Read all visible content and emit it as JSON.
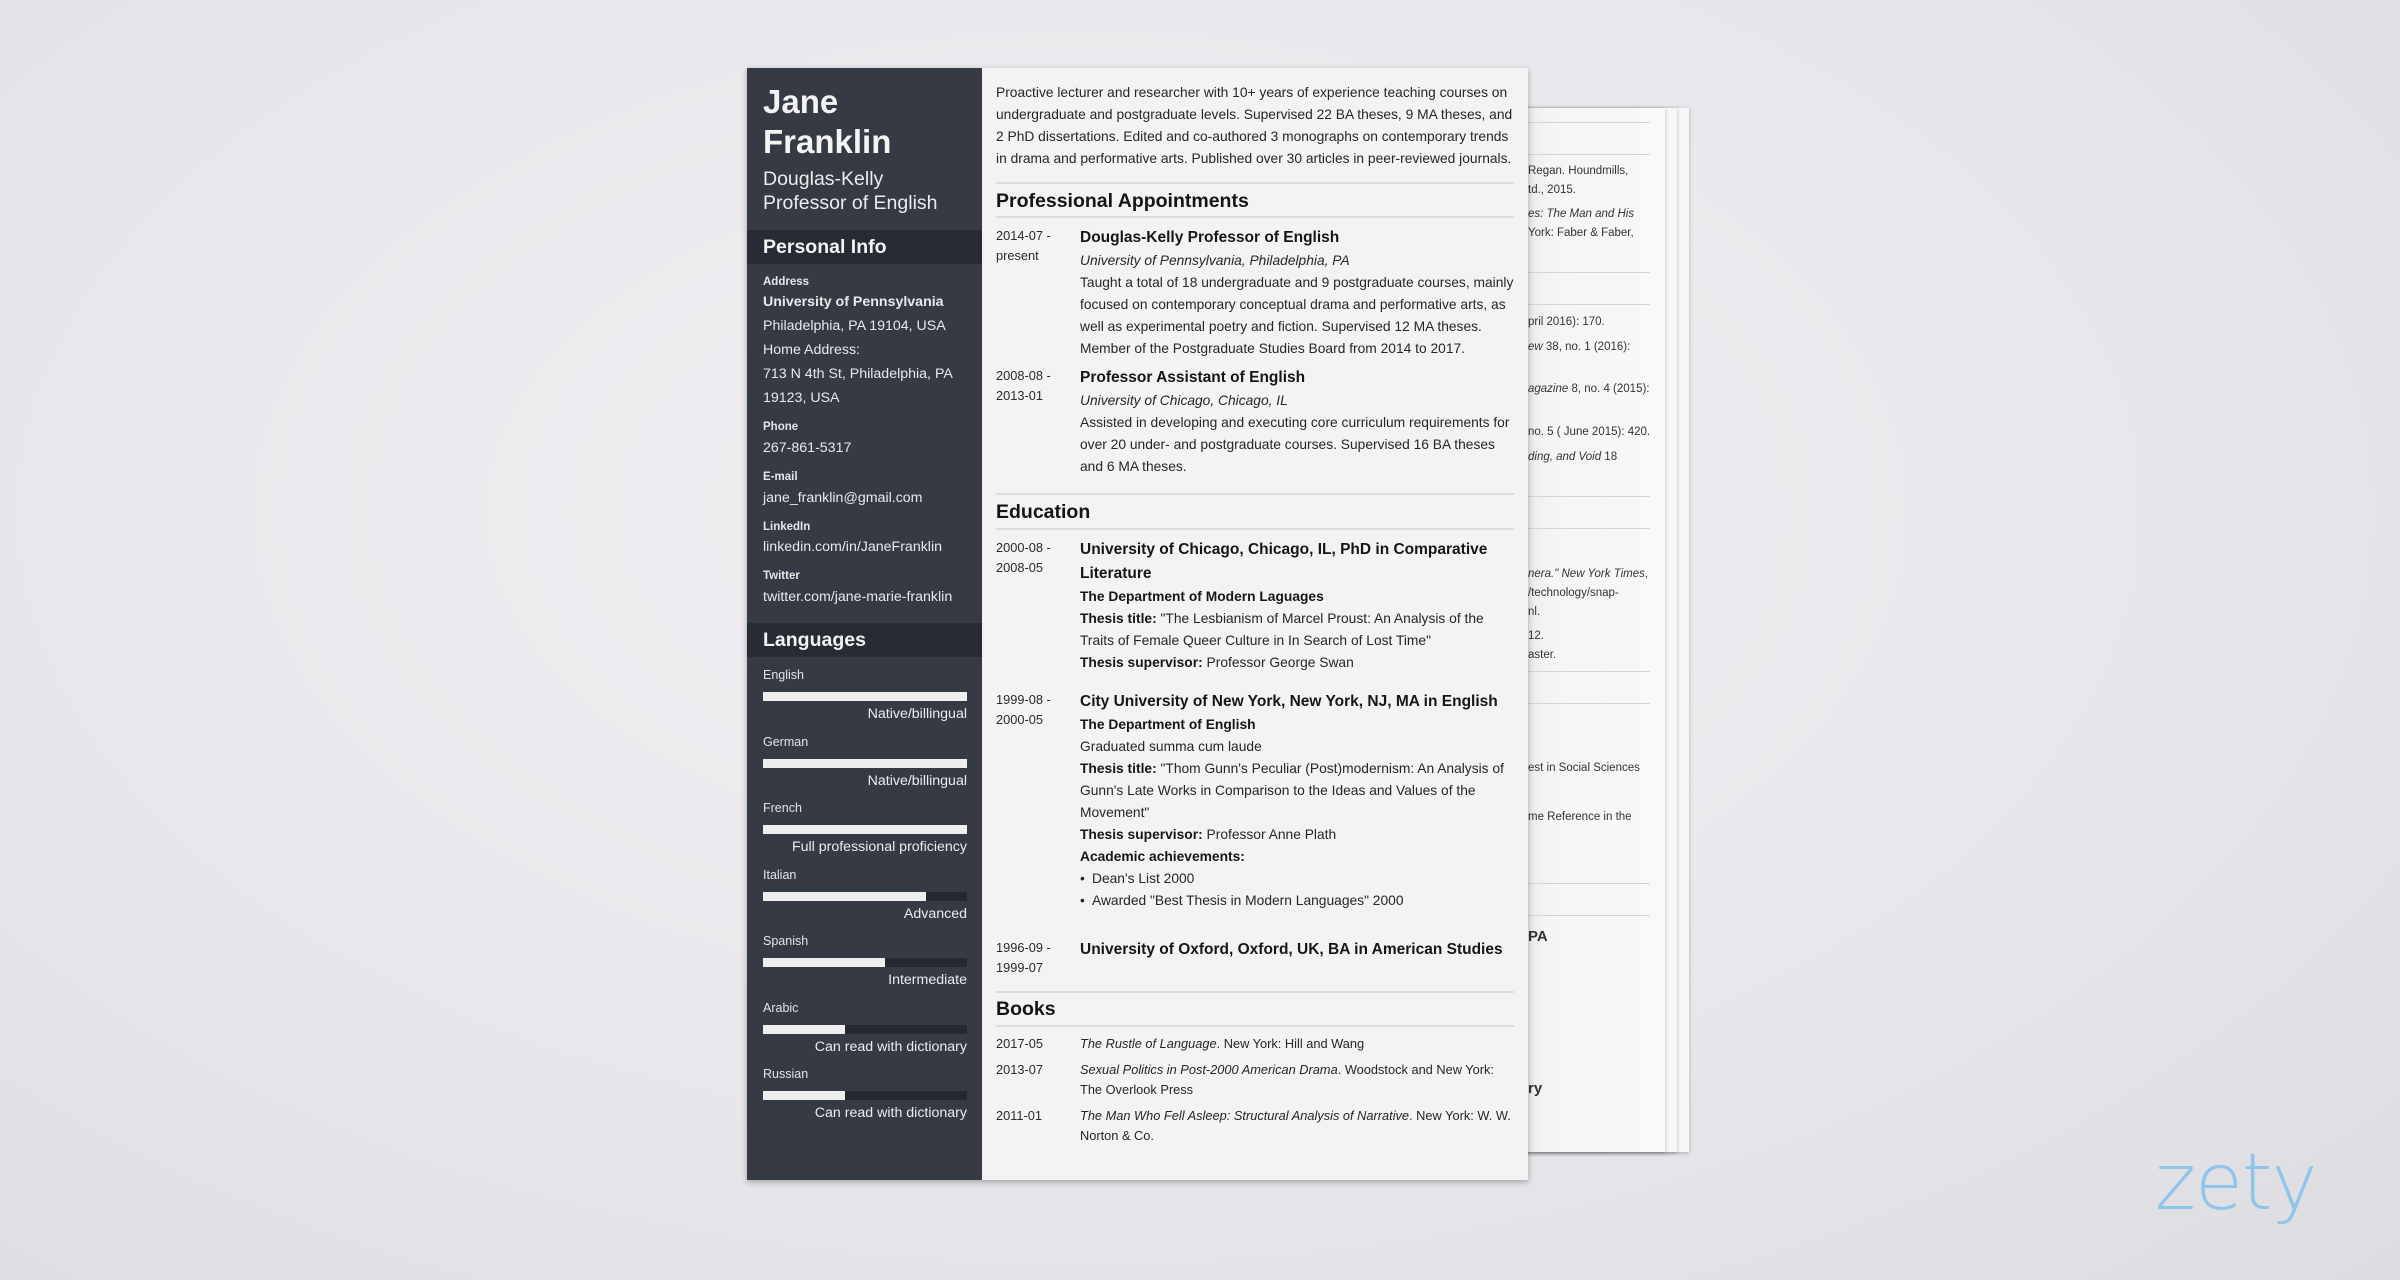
{
  "resume": {
    "name": "Jane Franklin",
    "name_line1": "Jane",
    "name_line2": "Franklin",
    "title_line1": "Douglas-Kelly",
    "title_line2": "Professor of English",
    "personal_info": {
      "heading": "Personal Info",
      "address_label": "Address",
      "address_org": "University of Pennsylvania",
      "address_city": "Philadelphia, PA 19104, USA",
      "home_label": "Home Address:",
      "home_line1": "713 N 4th St, Philadelphia, PA",
      "home_line2": "19123, USA",
      "phone_label": "Phone",
      "phone": "267-861-5317",
      "email_label": "E-mail",
      "email": "jane_franklin@gmail.com",
      "linkedin_label": "LinkedIn",
      "linkedin": "linkedin.com/in/JaneFranklin",
      "twitter_label": "Twitter",
      "twitter": "twitter.com/jane-marie-franklin"
    },
    "languages": {
      "heading": "Languages",
      "items": [
        {
          "name": "English",
          "level": "Native/billingual",
          "proficiency": 1.0
        },
        {
          "name": "German",
          "level": "Native/billingual",
          "proficiency": 1.0
        },
        {
          "name": "French",
          "level": "Full professional proficiency",
          "proficiency": 1.0
        },
        {
          "name": "Italian",
          "level": "Advanced",
          "proficiency": 0.8
        },
        {
          "name": "Spanish",
          "level": "Intermediate",
          "proficiency": 0.6
        },
        {
          "name": "Arabic",
          "level": "Can read with dictionary",
          "proficiency": 0.4
        },
        {
          "name": "Russian",
          "level": "Can read with dictionary",
          "proficiency": 0.4
        }
      ]
    },
    "summary": "Proactive lecturer and researcher with 10+ years of experience teaching courses on undergraduate and postgraduate levels. Supervised 22 BA theses, 9 MA theses, and 2 PhD dissertations. Edited and co-authored 3 monographs on contemporary trends in drama and performative arts. Published over 30 articles in peer-reviewed journals.",
    "appointments": {
      "heading": "Professional Appointments",
      "items": [
        {
          "date_start": "2014-07 -",
          "date_end": "present",
          "title": "Douglas-Kelly Professor of English",
          "org": "University of Pennsylvania, Philadelphia, PA",
          "desc": "Taught a total of 18 undergraduate and 9 postgraduate courses, mainly focused on contemporary conceptual drama and performative arts, as well as experimental poetry and fiction. Supervised 12 MA theses. Member of the Postgraduate Studies Board from 2014 to 2017."
        },
        {
          "date_start": "2008-08 -",
          "date_end": "2013-01",
          "title": "Professor Assistant of English",
          "org": "University of Chicago, Chicago, IL",
          "desc": "Assisted in developing and executing core curriculum requirements for over 20 under- and postgraduate courses. Supervised 16 BA theses and 6 MA theses."
        }
      ]
    },
    "education": {
      "heading": "Education",
      "thesis_title_label": "Thesis title:",
      "thesis_supervisor_label": "Thesis supervisor:",
      "achievements_label": "Academic achievements:",
      "items": [
        {
          "date_start": "2000-08 -",
          "date_end": "2008-05",
          "title": "University of Chicago, Chicago, IL, PhD in Comparative Literature",
          "department": "The Department of Modern Laguages",
          "thesis_title": "\"The Lesbianism of Marcel Proust: An Analysis of the Traits of Female Queer Culture in In Search of Lost Time\"",
          "thesis_supervisor": "Professor George Swan"
        },
        {
          "date_start": "1999-08 -",
          "date_end": "2000-05",
          "title": "City University of New York, New York, NJ, MA in English",
          "department": "The Department of English",
          "note": "Graduated summa cum laude",
          "thesis_title": "\"Thom Gunn's Peculiar (Post)modernism: An Analysis of Gunn's Late Works in Comparison to the Ideas and Values of the Movement\"",
          "thesis_supervisor": "Professor Anne Plath",
          "achievements": [
            "Dean's List 2000",
            "Awarded \"Best Thesis in Modern Languages\" 2000"
          ]
        },
        {
          "date_start": "1996-09 -",
          "date_end": "1999-07",
          "title": "University of Oxford, Oxford, UK, BA in American Studies"
        }
      ]
    },
    "books": {
      "heading": "Books",
      "items": [
        {
          "date": "2017-05",
          "title": "The Rustle of Language",
          "publisher": ". New York: Hill and Wang"
        },
        {
          "date": "2013-07",
          "title": "Sexual Politics in Post-2000 American Drama",
          "publisher": ". Woodstock and New York: The Overlook Press"
        },
        {
          "date": "2011-01",
          "title": "The Man Who Fell Asleep: Structural Analysis of Narrative",
          "publisher": ". New York: W. W. Norton & Co."
        }
      ]
    }
  },
  "back_page": {
    "fragments": [
      {
        "text": "Regan. Houndmills,",
        "italic": ""
      },
      {
        "text": "td., 2015.",
        "italic": ""
      },
      {
        "text": "",
        "italic": "es: The Man and His"
      },
      {
        "text": " York: Faber & Faber,",
        "italic": ""
      },
      {
        "text": "pril 2016): 170.",
        "italic": ""
      },
      {
        "text": " 38, no. 1 (2016):",
        "italic": "ew"
      },
      {
        "text": " 8, no. 4 (2015):",
        "italic": "agazine"
      },
      {
        "text": "no. 5 ( June 2015): 420.",
        "italic": ""
      },
      {
        "text": " 18",
        "italic": "ding, and Void"
      },
      {
        "text": ",",
        "italic": "nera.\" New York Times"
      },
      {
        "text": "/technology/snap-",
        "italic": ""
      },
      {
        "text": "nl.",
        "italic": ""
      },
      {
        "text": "12.",
        "italic": ""
      },
      {
        "text": "aster.",
        "italic": ""
      },
      {
        "text": "est in Social Sciences",
        "italic": ""
      },
      {
        "text": "me Reference in the",
        "italic": ""
      },
      {
        "text": "PA",
        "italic": ""
      },
      {
        "text": "ry",
        "italic": ""
      }
    ]
  },
  "brand": {
    "logo_text": "zety",
    "logo_color": "#8fc5ea",
    "sidebar_color": "#353a45",
    "sidebar_header_color": "#272b33"
  }
}
